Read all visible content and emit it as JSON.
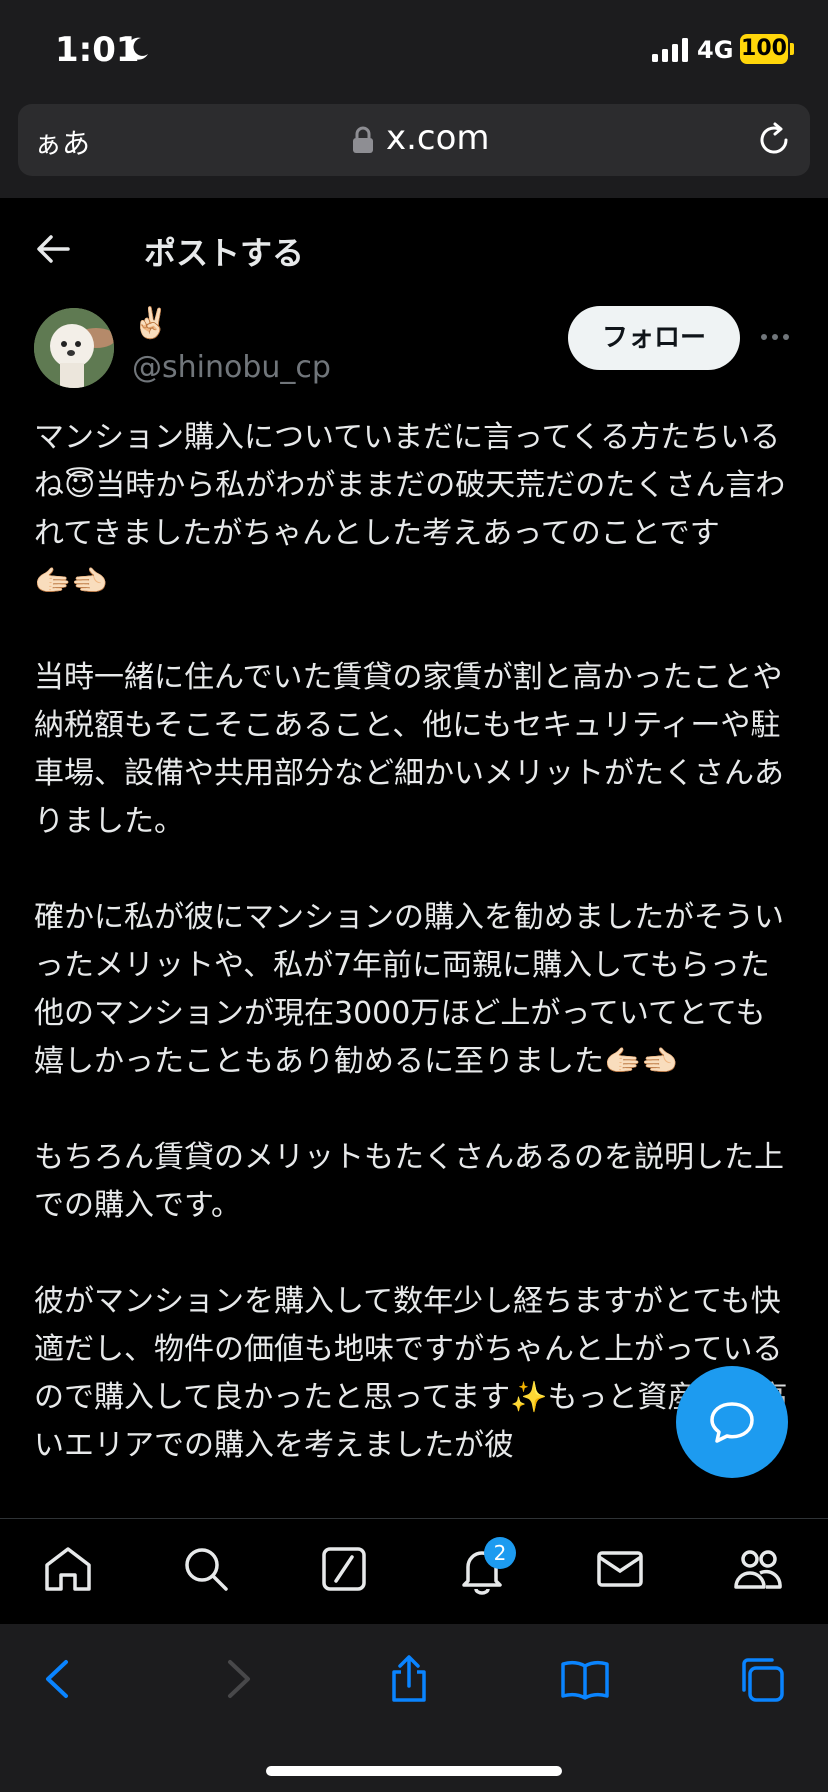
{
  "status_bar": {
    "time": "1:01",
    "network": "4G",
    "battery": "100"
  },
  "browser": {
    "aa_label": "ぁあ",
    "url": "x.com"
  },
  "header": {
    "title": "ポストする"
  },
  "author": {
    "display_name": "✌🏻",
    "handle": "@shinobu_cp",
    "follow_label": "フォロー"
  },
  "post": {
    "paragraphs": [
      "マンション購入についていまだに言ってくる方たちいるね😇当時から私がわがままだの破天荒だのたくさん言われてきましたがちゃんとした考えあってのことです🫱🏻‍🫲🏻",
      "当時一緒に住んでいた賃貸の家賃が割と高かったことや納税額もそこそこあること、他にもセキュリティーや駐車場、設備や共用部分など細かいメリットがたくさんありました。",
      "確かに私が彼にマンションの購入を勧めましたがそういったメリットや、私が7年前に両親に購入してもらった他のマンションが現在3000万ほど上がっていてとても嬉しかったこともあり勧めるに至りました🫱🏻‍🫲🏻",
      "もちろん賃貸のメリットもたくさんあるのを説明した上での購入です。",
      "彼がマンションを購入して数年少し経ちますがとても快適だし、物件の価値も地味ですがちゃんと上がっているので購入して良かったと思ってます✨もっと資産性が高いエリアでの購入を考えましたが彼"
    ]
  },
  "tab_bar": {
    "notification_count": "2"
  },
  "colors": {
    "accent": "#1d9bf0",
    "background": "#000000",
    "text": "#e7e9ea",
    "secondary_text": "#71767b",
    "battery": "#ffd60a"
  }
}
